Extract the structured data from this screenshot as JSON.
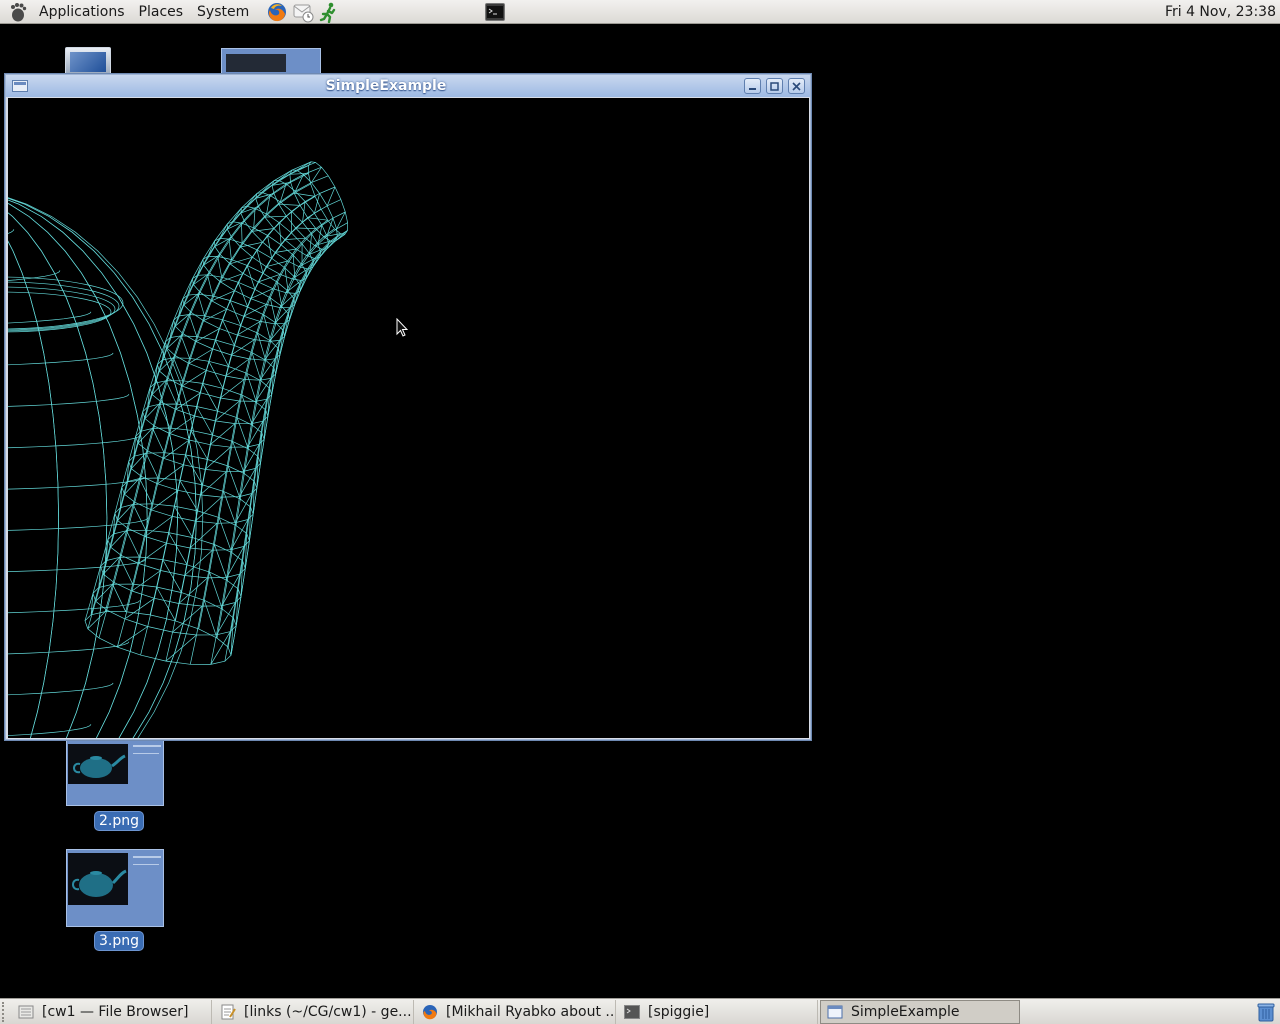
{
  "top_panel": {
    "menus": [
      "Applications",
      "Places",
      "System"
    ],
    "launchers": [
      "firefox-icon",
      "evolution-clock-icon",
      "running-man-icon"
    ],
    "terminal_applet": "terminal-icon",
    "clock": "Fri  4 Nov, 23:38"
  },
  "desktop": {
    "icons": [
      {
        "label": "2.png"
      },
      {
        "label": "3.png"
      }
    ]
  },
  "window": {
    "title": "SimpleExample",
    "buttons": [
      "minimize-icon",
      "maximize-icon",
      "close-icon"
    ],
    "content": "wireframe-teapot",
    "wire_color": "#6ef0f0",
    "background": "#000000"
  },
  "taskbar": {
    "tasks": [
      {
        "label": "[cw1 — File Browser]",
        "icon": "file-browser-icon",
        "active": false
      },
      {
        "label": "[links (~/CG/cw1) - ge...",
        "icon": "text-editor-icon",
        "active": false
      },
      {
        "label": "[Mikhail Ryabko about ...",
        "icon": "firefox-icon",
        "active": false
      },
      {
        "label": "[spiggie]",
        "icon": "terminal-icon",
        "active": false
      },
      {
        "label": "SimpleExample",
        "icon": "window-icon",
        "active": true
      }
    ],
    "trash_icon": "trash-icon"
  }
}
